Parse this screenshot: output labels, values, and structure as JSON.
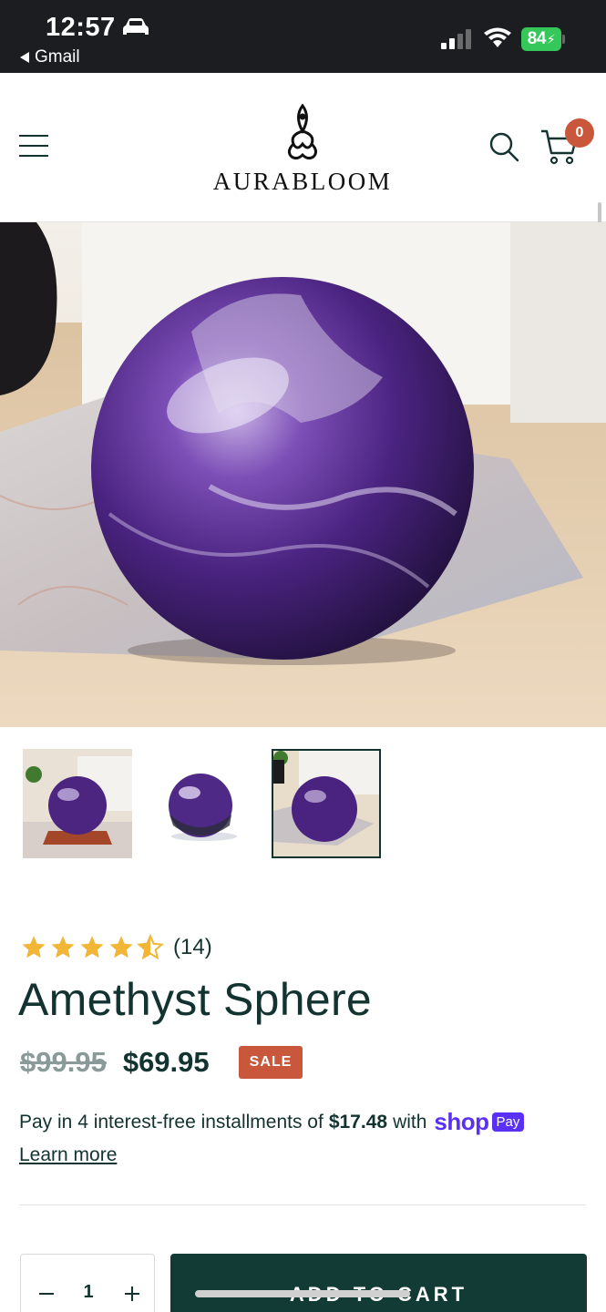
{
  "status_bar": {
    "time": "12:57",
    "back_app": "Gmail",
    "battery": "84"
  },
  "header": {
    "brand": "AURABLOOM",
    "cart_count": "0"
  },
  "product": {
    "rating_value": 4.5,
    "rating_count": "(14)",
    "title": "Amethyst Sphere",
    "compare_price": "$99.95",
    "price": "$69.95",
    "badge": "SALE",
    "installments_prefix": "Pay in 4 interest-free installments of",
    "installment_amount": "$17.48",
    "installments_suffix": "with",
    "shop_word": "shop",
    "pay_word": "Pay",
    "learn_more": "Learn more",
    "quantity": "1",
    "add_to_cart": "ADD TO CART",
    "thumbnails": [
      {
        "name": "sphere-on-stand",
        "active": false
      },
      {
        "name": "sphere-plain",
        "active": false
      },
      {
        "name": "sphere-on-table",
        "active": true
      }
    ]
  },
  "colors": {
    "primary": "#123b36",
    "sale": "#c9573b",
    "shop_pay": "#5a31f4",
    "star": "#f2b535"
  }
}
